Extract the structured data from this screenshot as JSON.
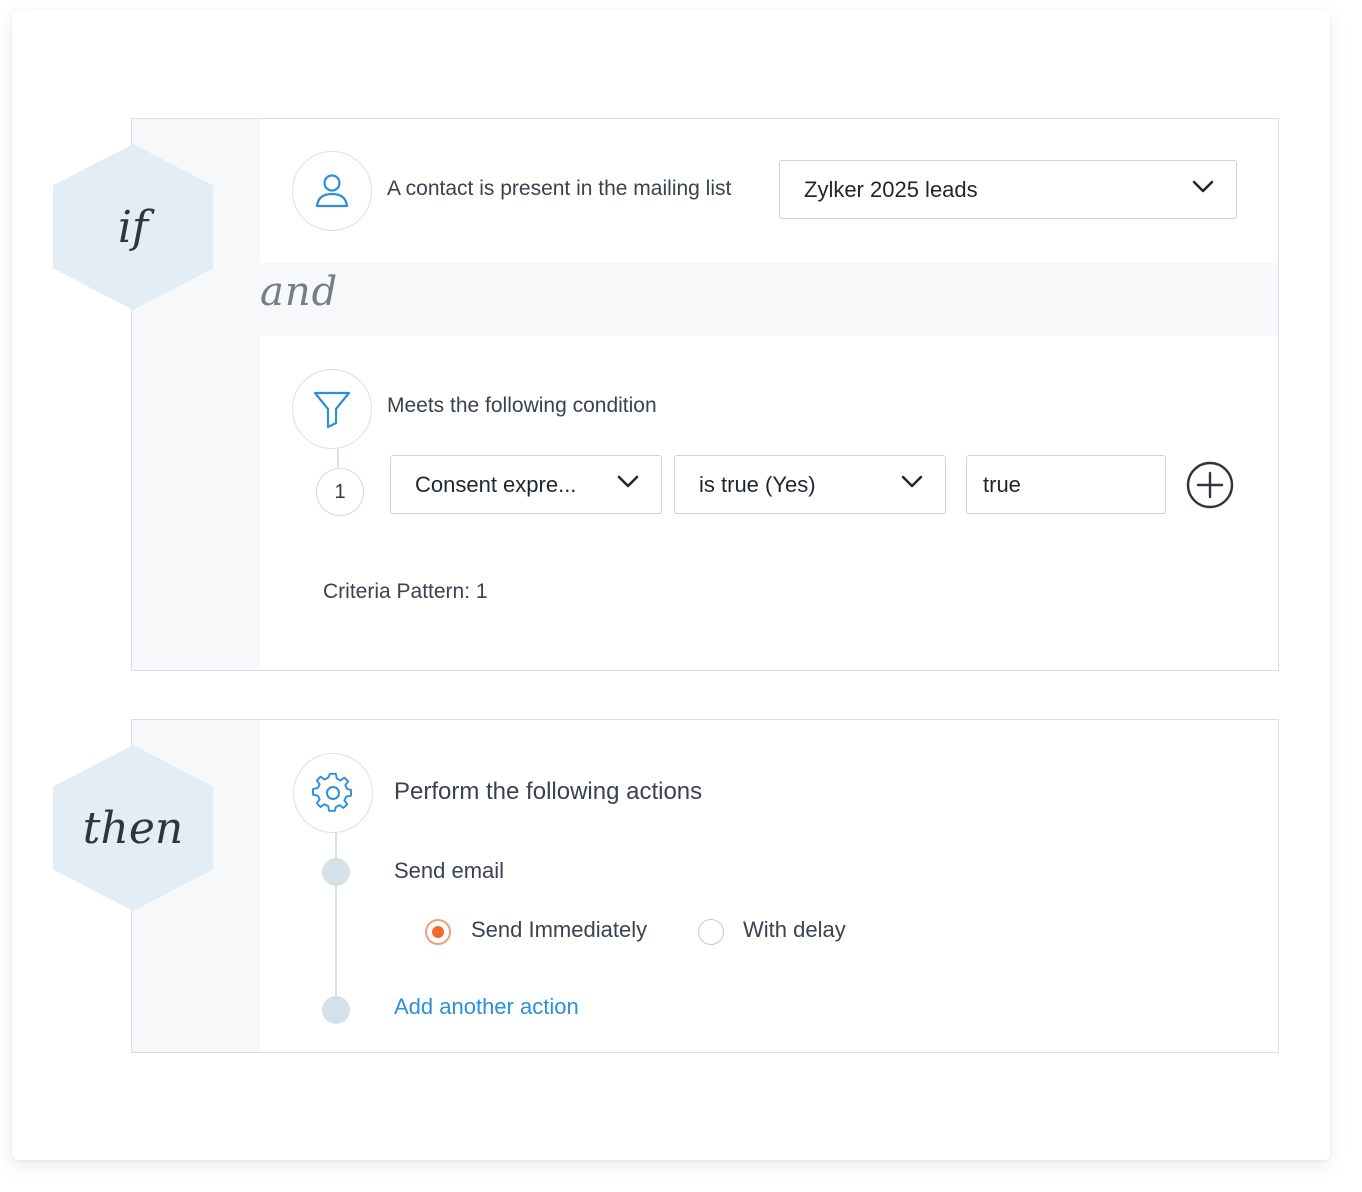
{
  "if_block": {
    "keyword": "if",
    "connector": "and",
    "trigger": {
      "icon": "user-icon",
      "text": "A contact is present in the mailing list",
      "mailing_list_value": "Zylker 2025 leads"
    },
    "condition": {
      "icon": "filter-icon",
      "text": "Meets the following condition",
      "rows": [
        {
          "number": "1",
          "field": "Consent expre...",
          "operator": "is true (Yes)",
          "value": "true"
        }
      ],
      "criteria_pattern": "Criteria Pattern: 1"
    }
  },
  "then_block": {
    "keyword": "then",
    "icon": "gear-icon",
    "title": "Perform the following actions",
    "action": "Send email",
    "options": [
      {
        "label": "Send Immediately",
        "checked": true
      },
      {
        "label": "With delay",
        "checked": false
      }
    ],
    "add_action_label": "Add another action"
  },
  "colors": {
    "accent_blue": "#2e8fd8",
    "radio_orange": "#f26a2e",
    "hex_fill": "#e3edf5"
  }
}
